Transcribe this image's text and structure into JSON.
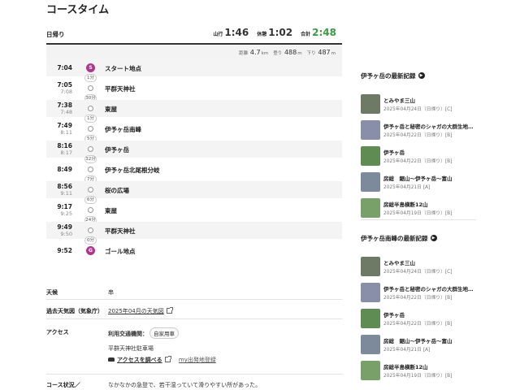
{
  "heading": "コースタイム",
  "summary": {
    "trip_type": "日帰り",
    "walk_label": "山行",
    "walk_time": "1:46",
    "rest_label": "休憩",
    "rest_time": "1:02",
    "total_label": "合計",
    "total_time": "2:48",
    "distance_label": "距離",
    "distance_value": "4.7",
    "distance_unit": "km",
    "up_label": "登り",
    "up_value": "488",
    "up_unit": "m",
    "down_label": "下り",
    "down_value": "487",
    "down_unit": "m"
  },
  "timeline": {
    "points": [
      {
        "arrive": "7:04",
        "depart": "",
        "name": "スタート地点",
        "marker": "S"
      },
      {
        "arrive": "7:05",
        "depart": "7:08",
        "name": "平群天神社",
        "marker": ""
      },
      {
        "arrive": "7:38",
        "depart": "7:48",
        "name": "東屋",
        "marker": ""
      },
      {
        "arrive": "7:49",
        "depart": "8:11",
        "name": "伊予ヶ岳南峰",
        "marker": ""
      },
      {
        "arrive": "8:16",
        "depart": "8:17",
        "name": "伊予ヶ岳",
        "marker": ""
      },
      {
        "arrive": "8:49",
        "depart": "",
        "name": "伊予ヶ岳北尾根分岐",
        "marker": ""
      },
      {
        "arrive": "8:56",
        "depart": "9:11",
        "name": "桜の広場",
        "marker": ""
      },
      {
        "arrive": "9:17",
        "depart": "9:25",
        "name": "東屋",
        "marker": ""
      },
      {
        "arrive": "9:49",
        "depart": "9:50",
        "name": "平群天神社",
        "marker": ""
      },
      {
        "arrive": "9:52",
        "depart": "",
        "name": "ゴール地点",
        "marker": "G"
      }
    ],
    "segments": [
      "1分",
      "30分",
      "1分",
      "5分",
      "32分",
      "7分",
      "6分",
      "24分",
      "0分"
    ]
  },
  "info": {
    "weather_label": "天候",
    "weather_value": "串",
    "past_weather_label": "過去天気図（気象庁）",
    "past_weather_link": "2025年04月の天気図",
    "access_label": "アクセス",
    "transport_label": "利用交通機関：",
    "transport_value": "自家用車",
    "parking": "平群天神社駐車場",
    "access_link": "アクセスを調べる",
    "map_link": "my出発地登録",
    "course_label": "コース状況／",
    "course_value": "なかなかの急登で、若干湿っていて滑りやすい所があった。"
  },
  "sidebar": {
    "section1": {
      "title": "伊予ヶ岳の最新記録",
      "items": [
        {
          "name": "とみやま三山",
          "date": "2025年04月24日（日帰り）[C]",
          "thumb": "#6f7a66"
        },
        {
          "name": "伊予ヶ岳と秘密のシャガの大群生地…",
          "date": "2025年04月22日（日帰り）[B]",
          "thumb": "#8a8fa8"
        },
        {
          "name": "伊予ヶ岳",
          "date": "2025年04月22日（日帰り）[B]",
          "thumb": "#5f8c52"
        },
        {
          "name": "房総　鋸山〜伊予ヶ岳〜富山",
          "date": "2025年04月21日 [A]",
          "thumb": "#7d8a99"
        },
        {
          "name": "房総半島横断12山",
          "date": "2025年04月19日（日帰り）[B]",
          "thumb": "#7aa06a"
        }
      ]
    },
    "section2": {
      "title": "伊予ヶ岳南峰の最新記録",
      "items": [
        {
          "name": "とみやま三山",
          "date": "2025年04月24日（日帰り）[C]",
          "thumb": "#6f7a66"
        },
        {
          "name": "伊予ヶ岳と秘密のシャガの大群生地…",
          "date": "2025年04月22日（日帰り）[B]",
          "thumb": "#8a8fa8"
        },
        {
          "name": "伊予ヶ岳",
          "date": "2025年04月22日（日帰り）[B]",
          "thumb": "#5f8c52"
        },
        {
          "name": "房総　鋸山〜伊予ヶ岳〜富山",
          "date": "2025年04月21日 [A]",
          "thumb": "#7d8a99"
        },
        {
          "name": "房総半島横断12山",
          "date": "2025年04月19日（日帰り）[B]",
          "thumb": "#7aa06a"
        }
      ]
    }
  }
}
